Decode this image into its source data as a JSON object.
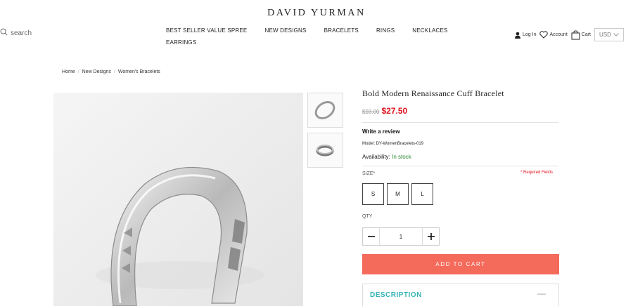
{
  "brand": "DAVID YURMAN",
  "search": {
    "label": "search",
    "icon": "search-icon"
  },
  "nav": [
    "BEST SELLER VALUE SPREE",
    "NEW DESIGNS",
    "BRACELETS",
    "RINGS",
    "NECKLACES",
    "EARRINGS"
  ],
  "account_bar": {
    "login": "Log In",
    "account": "Account",
    "cart": "Cart",
    "currency": "USD"
  },
  "breadcrumb": [
    "Home",
    "New Designs",
    "Women's Bracelets"
  ],
  "product": {
    "title": "Bold Modern Renaissance Cuff Bracelet",
    "old_price": "$93.00",
    "price": "$27.50",
    "review_link": "Write a review",
    "model": "Model: DY-WomenBracelets-019",
    "availability_label": "Availability:",
    "availability_value": "In stock",
    "size_label": "SIZE*",
    "required_note": "* Required Fields",
    "sizes": [
      "S",
      "M",
      "L"
    ],
    "qty_label": "QTY",
    "qty_value": "1",
    "add_to_cart": "ADD TO CART",
    "description_label": "DESCRIPTION",
    "description_toggle": "—"
  },
  "colors": {
    "accent": "#f46a5b",
    "sale": "#e0131f",
    "in_stock": "#2c8a33",
    "description": "#35b3b5"
  }
}
